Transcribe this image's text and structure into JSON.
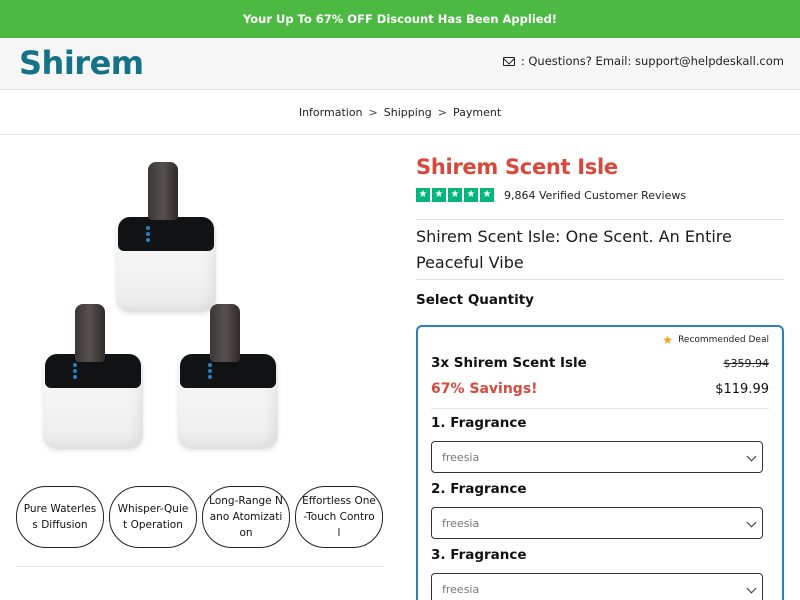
{
  "promo": {
    "text": "Your Up To 67% OFF Discount Has Been Applied!"
  },
  "header": {
    "logo": "Shirem",
    "support_icon": "envelope-icon",
    "support_text": ": Questions? Email: support@helpdeskall.com"
  },
  "breadcrumb": {
    "items": [
      "Information",
      "Shipping",
      "Payment"
    ],
    "separator": ">"
  },
  "gallery": {
    "image_alt": "Three Shirem Scent Isle diffusers"
  },
  "features": [
    "Pure Waterless Diffusion",
    "Whisper-Quiet Operation",
    "Long-Range Nano Atomization",
    "Effortless One-Touch Control"
  ],
  "product": {
    "title": "Shirem Scent Isle",
    "rating_stars": 5,
    "rating_text": "9,864 Verified Customer Reviews",
    "tagline": "Shirem Scent Isle: One Scent. An Entire Peaceful Vibe",
    "select_quantity_label": "Select Quantity"
  },
  "deal": {
    "badge": "Recommended Deal",
    "name": "3x Shirem Scent Isle",
    "old_price": "$359.94",
    "savings": "67% Savings!",
    "new_price": "$119.99",
    "fragrances": [
      {
        "label": "1. Fragrance",
        "value": "freesia"
      },
      {
        "label": "2. Fragrance",
        "value": "freesia"
      },
      {
        "label": "3. Fragrance",
        "value": "freesia"
      }
    ]
  },
  "colors": {
    "promo_green": "#4cba42",
    "logo_teal": "#157287",
    "accent_red": "#d9483b",
    "trustpilot_green": "#00b67a",
    "deal_border_blue": "#2e7ec6"
  }
}
